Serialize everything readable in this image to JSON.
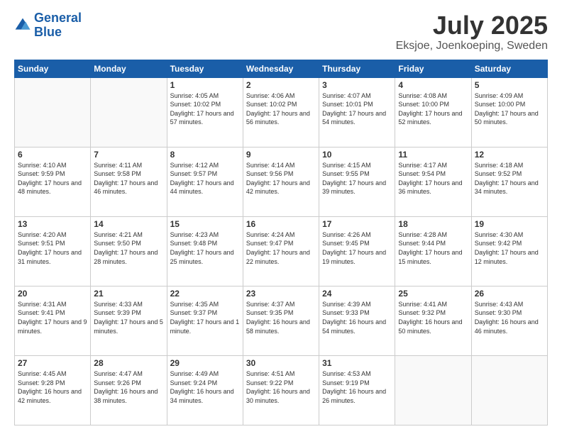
{
  "logo": {
    "line1": "General",
    "line2": "Blue"
  },
  "title": "July 2025",
  "subtitle": "Eksjoe, Joenkoeping, Sweden",
  "days_header": [
    "Sunday",
    "Monday",
    "Tuesday",
    "Wednesday",
    "Thursday",
    "Friday",
    "Saturday"
  ],
  "weeks": [
    [
      {
        "num": "",
        "sunrise": "",
        "sunset": "",
        "daylight": ""
      },
      {
        "num": "",
        "sunrise": "",
        "sunset": "",
        "daylight": ""
      },
      {
        "num": "1",
        "sunrise": "Sunrise: 4:05 AM",
        "sunset": "Sunset: 10:02 PM",
        "daylight": "Daylight: 17 hours and 57 minutes."
      },
      {
        "num": "2",
        "sunrise": "Sunrise: 4:06 AM",
        "sunset": "Sunset: 10:02 PM",
        "daylight": "Daylight: 17 hours and 56 minutes."
      },
      {
        "num": "3",
        "sunrise": "Sunrise: 4:07 AM",
        "sunset": "Sunset: 10:01 PM",
        "daylight": "Daylight: 17 hours and 54 minutes."
      },
      {
        "num": "4",
        "sunrise": "Sunrise: 4:08 AM",
        "sunset": "Sunset: 10:00 PM",
        "daylight": "Daylight: 17 hours and 52 minutes."
      },
      {
        "num": "5",
        "sunrise": "Sunrise: 4:09 AM",
        "sunset": "Sunset: 10:00 PM",
        "daylight": "Daylight: 17 hours and 50 minutes."
      }
    ],
    [
      {
        "num": "6",
        "sunrise": "Sunrise: 4:10 AM",
        "sunset": "Sunset: 9:59 PM",
        "daylight": "Daylight: 17 hours and 48 minutes."
      },
      {
        "num": "7",
        "sunrise": "Sunrise: 4:11 AM",
        "sunset": "Sunset: 9:58 PM",
        "daylight": "Daylight: 17 hours and 46 minutes."
      },
      {
        "num": "8",
        "sunrise": "Sunrise: 4:12 AM",
        "sunset": "Sunset: 9:57 PM",
        "daylight": "Daylight: 17 hours and 44 minutes."
      },
      {
        "num": "9",
        "sunrise": "Sunrise: 4:14 AM",
        "sunset": "Sunset: 9:56 PM",
        "daylight": "Daylight: 17 hours and 42 minutes."
      },
      {
        "num": "10",
        "sunrise": "Sunrise: 4:15 AM",
        "sunset": "Sunset: 9:55 PM",
        "daylight": "Daylight: 17 hours and 39 minutes."
      },
      {
        "num": "11",
        "sunrise": "Sunrise: 4:17 AM",
        "sunset": "Sunset: 9:54 PM",
        "daylight": "Daylight: 17 hours and 36 minutes."
      },
      {
        "num": "12",
        "sunrise": "Sunrise: 4:18 AM",
        "sunset": "Sunset: 9:52 PM",
        "daylight": "Daylight: 17 hours and 34 minutes."
      }
    ],
    [
      {
        "num": "13",
        "sunrise": "Sunrise: 4:20 AM",
        "sunset": "Sunset: 9:51 PM",
        "daylight": "Daylight: 17 hours and 31 minutes."
      },
      {
        "num": "14",
        "sunrise": "Sunrise: 4:21 AM",
        "sunset": "Sunset: 9:50 PM",
        "daylight": "Daylight: 17 hours and 28 minutes."
      },
      {
        "num": "15",
        "sunrise": "Sunrise: 4:23 AM",
        "sunset": "Sunset: 9:48 PM",
        "daylight": "Daylight: 17 hours and 25 minutes."
      },
      {
        "num": "16",
        "sunrise": "Sunrise: 4:24 AM",
        "sunset": "Sunset: 9:47 PM",
        "daylight": "Daylight: 17 hours and 22 minutes."
      },
      {
        "num": "17",
        "sunrise": "Sunrise: 4:26 AM",
        "sunset": "Sunset: 9:45 PM",
        "daylight": "Daylight: 17 hours and 19 minutes."
      },
      {
        "num": "18",
        "sunrise": "Sunrise: 4:28 AM",
        "sunset": "Sunset: 9:44 PM",
        "daylight": "Daylight: 17 hours and 15 minutes."
      },
      {
        "num": "19",
        "sunrise": "Sunrise: 4:30 AM",
        "sunset": "Sunset: 9:42 PM",
        "daylight": "Daylight: 17 hours and 12 minutes."
      }
    ],
    [
      {
        "num": "20",
        "sunrise": "Sunrise: 4:31 AM",
        "sunset": "Sunset: 9:41 PM",
        "daylight": "Daylight: 17 hours and 9 minutes."
      },
      {
        "num": "21",
        "sunrise": "Sunrise: 4:33 AM",
        "sunset": "Sunset: 9:39 PM",
        "daylight": "Daylight: 17 hours and 5 minutes."
      },
      {
        "num": "22",
        "sunrise": "Sunrise: 4:35 AM",
        "sunset": "Sunset: 9:37 PM",
        "daylight": "Daylight: 17 hours and 1 minute."
      },
      {
        "num": "23",
        "sunrise": "Sunrise: 4:37 AM",
        "sunset": "Sunset: 9:35 PM",
        "daylight": "Daylight: 16 hours and 58 minutes."
      },
      {
        "num": "24",
        "sunrise": "Sunrise: 4:39 AM",
        "sunset": "Sunset: 9:33 PM",
        "daylight": "Daylight: 16 hours and 54 minutes."
      },
      {
        "num": "25",
        "sunrise": "Sunrise: 4:41 AM",
        "sunset": "Sunset: 9:32 PM",
        "daylight": "Daylight: 16 hours and 50 minutes."
      },
      {
        "num": "26",
        "sunrise": "Sunrise: 4:43 AM",
        "sunset": "Sunset: 9:30 PM",
        "daylight": "Daylight: 16 hours and 46 minutes."
      }
    ],
    [
      {
        "num": "27",
        "sunrise": "Sunrise: 4:45 AM",
        "sunset": "Sunset: 9:28 PM",
        "daylight": "Daylight: 16 hours and 42 minutes."
      },
      {
        "num": "28",
        "sunrise": "Sunrise: 4:47 AM",
        "sunset": "Sunset: 9:26 PM",
        "daylight": "Daylight: 16 hours and 38 minutes."
      },
      {
        "num": "29",
        "sunrise": "Sunrise: 4:49 AM",
        "sunset": "Sunset: 9:24 PM",
        "daylight": "Daylight: 16 hours and 34 minutes."
      },
      {
        "num": "30",
        "sunrise": "Sunrise: 4:51 AM",
        "sunset": "Sunset: 9:22 PM",
        "daylight": "Daylight: 16 hours and 30 minutes."
      },
      {
        "num": "31",
        "sunrise": "Sunrise: 4:53 AM",
        "sunset": "Sunset: 9:19 PM",
        "daylight": "Daylight: 16 hours and 26 minutes."
      },
      {
        "num": "",
        "sunrise": "",
        "sunset": "",
        "daylight": ""
      },
      {
        "num": "",
        "sunrise": "",
        "sunset": "",
        "daylight": ""
      }
    ]
  ]
}
